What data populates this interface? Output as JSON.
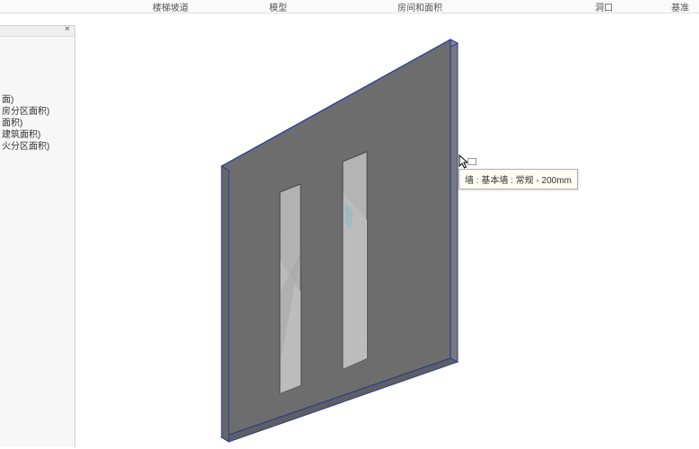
{
  "ribbon": {
    "tabs": [
      "楼梯坡道",
      "模型",
      "房间和面积",
      "洞口",
      "基准"
    ]
  },
  "side_panel": {
    "close_glyph": "×",
    "items": [
      "面)",
      "房分区面积)",
      "面积)",
      "建筑面积)",
      "火分区面积)"
    ]
  },
  "tooltip": {
    "text": "墙 : 基本墙 : 常规 - 200mm"
  }
}
